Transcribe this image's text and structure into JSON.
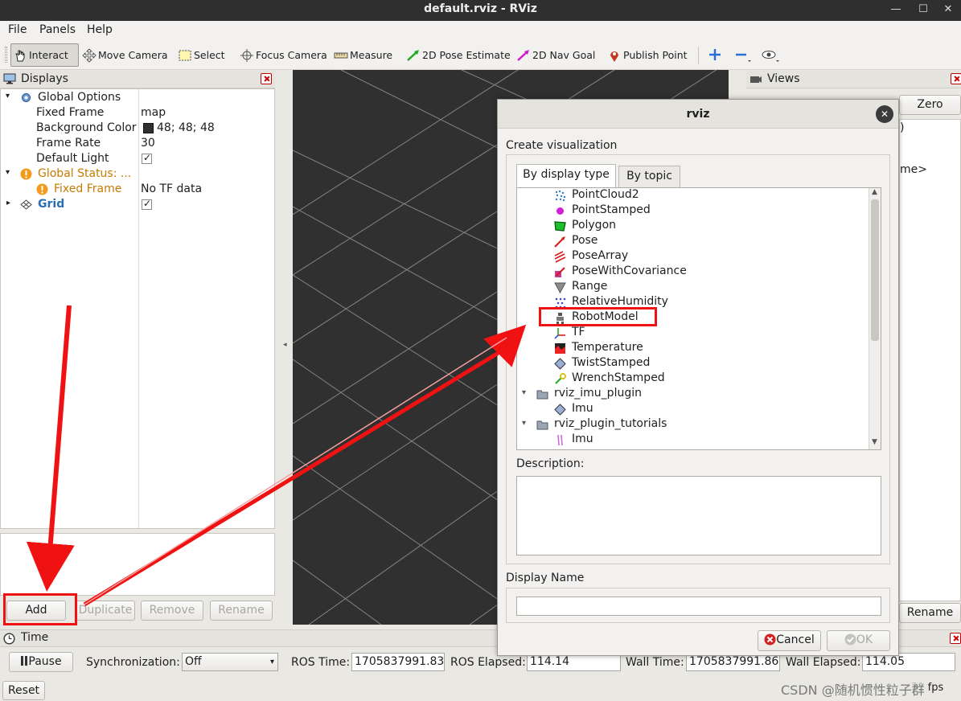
{
  "window": {
    "title": "default.rviz - RViz"
  },
  "menu": [
    "File",
    "Panels",
    "Help"
  ],
  "toolbar": {
    "tools": [
      "Interact",
      "Move Camera",
      "Select",
      "Focus Camera",
      "Measure",
      "2D Pose Estimate",
      "2D Nav Goal",
      "Publish Point"
    ],
    "active": "Interact"
  },
  "displays": {
    "title": "Displays",
    "rows": [
      {
        "label": "Global Options",
        "value": ""
      },
      {
        "label": "Fixed Frame",
        "value": "map"
      },
      {
        "label": "Background Color",
        "value": "48; 48; 48"
      },
      {
        "label": "Frame Rate",
        "value": "30"
      },
      {
        "label": "Default Light",
        "value": ""
      },
      {
        "label": "Global Status: ...",
        "value": ""
      },
      {
        "label": "Fixed Frame",
        "value": "No TF data"
      },
      {
        "label": "Grid",
        "value": ""
      }
    ],
    "buttons": {
      "add": "Add",
      "duplicate": "Duplicate",
      "remove": "Remove",
      "rename": "Rename"
    },
    "bg_color": "#303030"
  },
  "views": {
    "title": "Views",
    "zero": "Zero",
    "rename": "Rename",
    "partial_1": ")",
    "partial_2": "me>"
  },
  "dialog": {
    "title": "rviz",
    "create_label": "Create visualization",
    "tabs": [
      "By display type",
      "By topic"
    ],
    "items": [
      {
        "label": "PointCloud2",
        "icon": "pointcloud-icon"
      },
      {
        "label": "PointStamped",
        "icon": "point-icon"
      },
      {
        "label": "Polygon",
        "icon": "polygon-icon"
      },
      {
        "label": "Pose",
        "icon": "pose-icon"
      },
      {
        "label": "PoseArray",
        "icon": "posearray-icon"
      },
      {
        "label": "PoseWithCovariance",
        "icon": "posecov-icon"
      },
      {
        "label": "Range",
        "icon": "range-icon"
      },
      {
        "label": "RelativeHumidity",
        "icon": "humidity-icon"
      },
      {
        "label": "RobotModel",
        "icon": "robot-icon"
      },
      {
        "label": "TF",
        "icon": "tf-icon"
      },
      {
        "label": "Temperature",
        "icon": "temperature-icon"
      },
      {
        "label": "TwistStamped",
        "icon": "twist-icon"
      },
      {
        "label": "WrenchStamped",
        "icon": "wrench-icon"
      },
      {
        "label": "rviz_imu_plugin",
        "icon": "folder-icon"
      },
      {
        "label": "Imu",
        "icon": "imu-icon"
      },
      {
        "label": "rviz_plugin_tutorials",
        "icon": "folder-icon"
      },
      {
        "label": "Imu",
        "icon": "imu2-icon"
      }
    ],
    "description_label": "Description:",
    "display_name_label": "Display Name",
    "display_name_value": "",
    "cancel": "Cancel",
    "ok": "OK"
  },
  "time": {
    "title": "Time",
    "pause": "Pause",
    "sync_label": "Synchronization:",
    "sync_value": "Off",
    "ros_time_label": "ROS Time:",
    "ros_time": "1705837991.83",
    "ros_elapsed_label": "ROS Elapsed:",
    "ros_elapsed": "114.14",
    "wall_time_label": "Wall Time:",
    "wall_time": "1705837991.86",
    "wall_elapsed_label": "Wall Elapsed:",
    "wall_elapsed": "114.05",
    "reset": "Reset",
    "fps": "31 fps"
  },
  "watermark": "CSDN @随机惯性粒子群",
  "colors": {
    "accent_red": "#f01212",
    "warning": "#c67a00",
    "link_blue": "#2a6fb5"
  }
}
